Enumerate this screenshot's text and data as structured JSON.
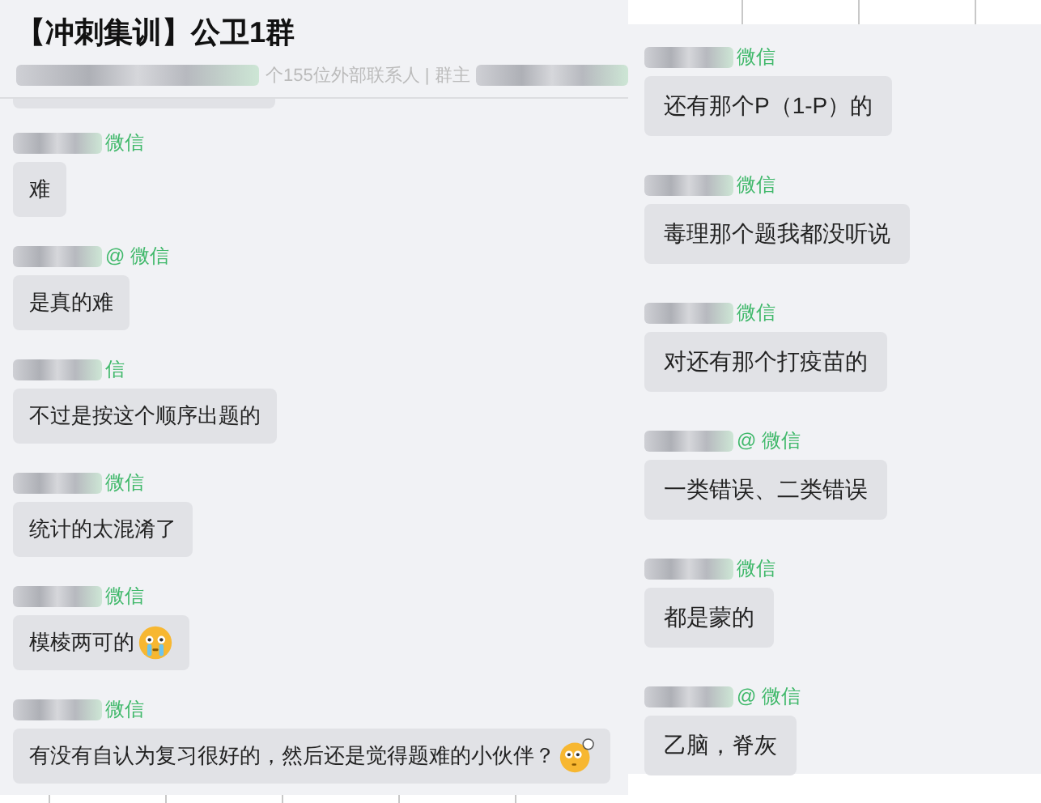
{
  "chat": {
    "title": "【冲刺集训】公卫1群",
    "subtitle": "个155位外部联系人 | 群主"
  },
  "left_messages": [
    {
      "sender_suffix": "微信",
      "text": "难"
    },
    {
      "sender_suffix": "@ 微信",
      "text": "是真的难"
    },
    {
      "sender_suffix": "信",
      "text": "不过是按这个顺序出题的"
    },
    {
      "sender_suffix": "微信",
      "text": "统计的太混淆了"
    },
    {
      "sender_suffix": "微信",
      "text": "模棱两可的",
      "kind": "tearful_emoji"
    },
    {
      "sender_suffix": "微信",
      "text": "有没有自认为复习很好的，然后还是觉得题难的小伙伴？",
      "kind": "thinking_emoji"
    }
  ],
  "right_messages": [
    {
      "sender_suffix": "微信",
      "text": "还有那个P（1-P）的"
    },
    {
      "sender_suffix": "微信",
      "text": "毒理那个题我都没听说"
    },
    {
      "sender_suffix": "微信",
      "text": "对还有那个打疫苗的"
    },
    {
      "sender_suffix": "@ 微信",
      "text": "一类错误、二类错误"
    },
    {
      "sender_suffix": "微信",
      "text": "都是蒙的"
    },
    {
      "sender_suffix": "@ 微信",
      "text": "乙脑，脊灰"
    }
  ]
}
